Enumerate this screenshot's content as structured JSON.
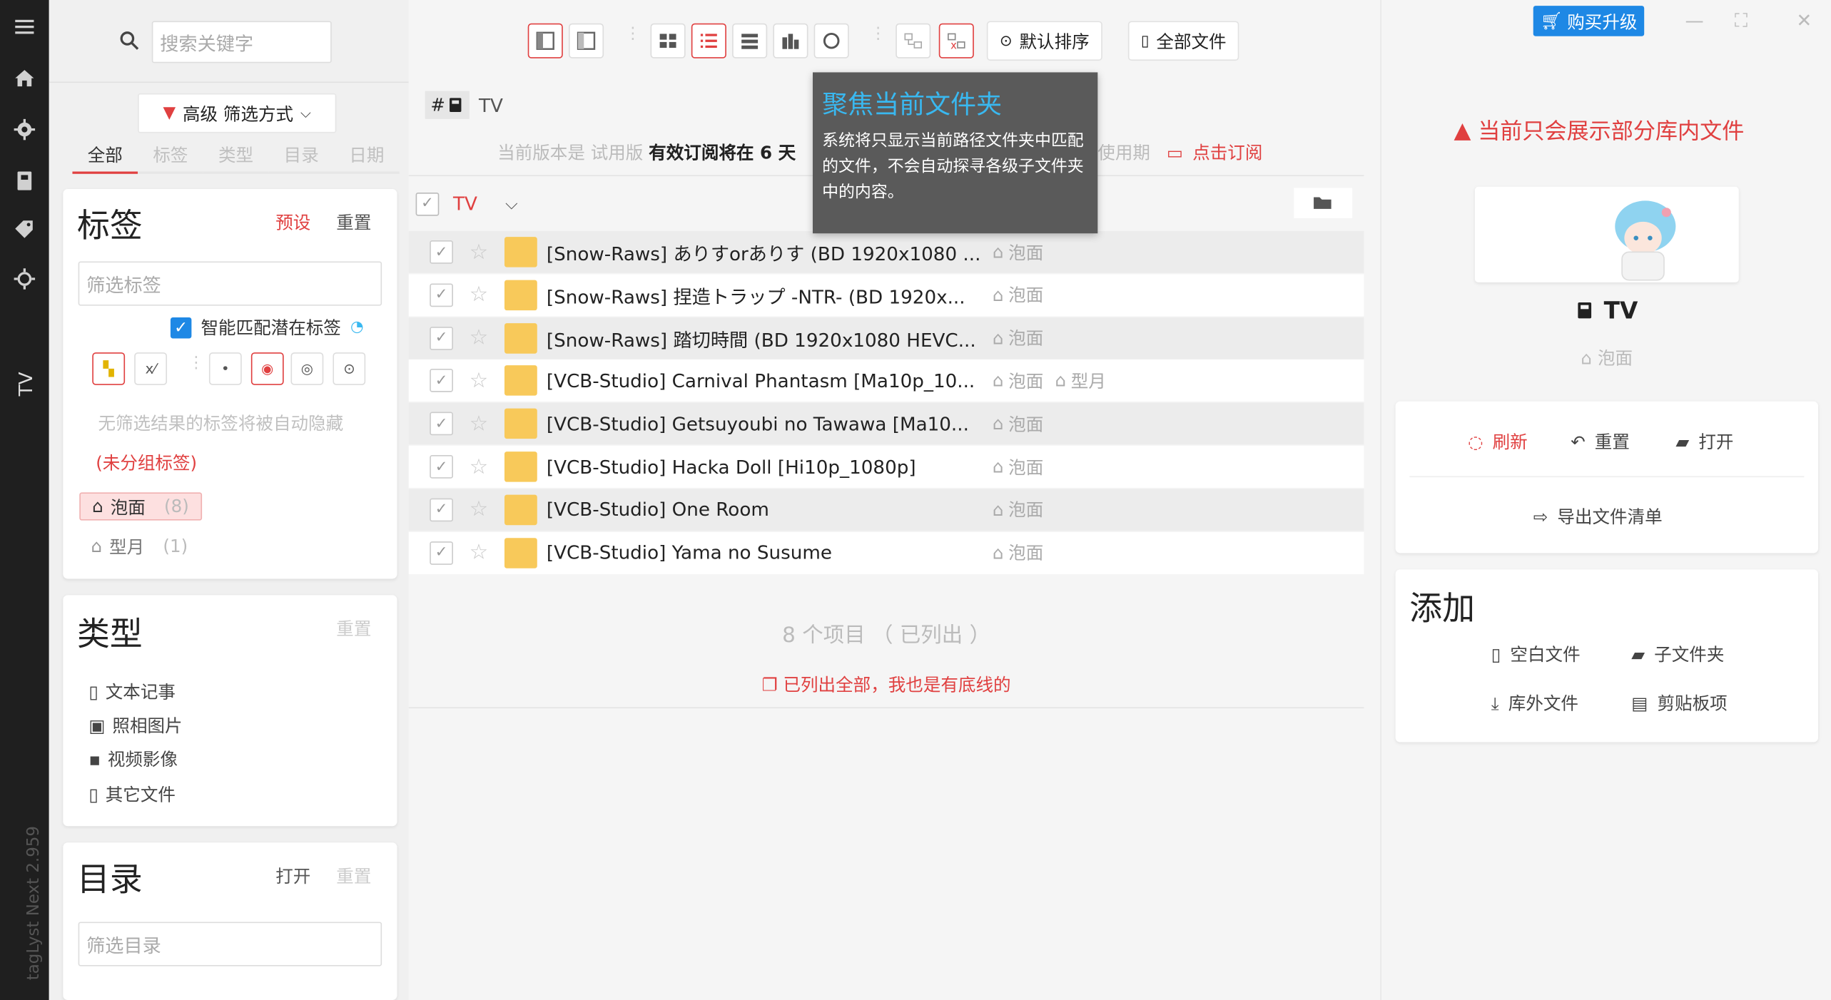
{
  "app": {
    "version_label": "tagLyst Next 2.959",
    "rail_folder": "TV"
  },
  "filter_panel": {
    "search_placeholder": "搜索关键字",
    "advanced_filter_label": "高级 筛选方式",
    "tabs": [
      {
        "label": "全部",
        "active": true
      },
      {
        "label": "标签",
        "active": false
      },
      {
        "label": "类型",
        "active": false
      },
      {
        "label": "目录",
        "active": false
      },
      {
        "label": "日期",
        "active": false
      }
    ],
    "tag_card": {
      "title": "标签",
      "preset": "预设",
      "reset": "重置",
      "filter_placeholder": "筛选标签",
      "smart_match": "智能匹配潜在标签",
      "hint": "无筛选结果的标签将被自动隐藏",
      "ungrouped": "(未分组标签)",
      "tags": [
        {
          "name": "泡面",
          "count": "(8)",
          "selected": true
        },
        {
          "name": "型月",
          "count": "(1)",
          "selected": false
        }
      ]
    },
    "type_card": {
      "title": "类型",
      "reset": "重置",
      "types": [
        {
          "label": "文本记事",
          "icon": "document-icon"
        },
        {
          "label": "照相图片",
          "icon": "image-icon"
        },
        {
          "label": "视频影像",
          "icon": "video-icon"
        },
        {
          "label": "其它文件",
          "icon": "file-icon"
        }
      ]
    },
    "dir_card": {
      "title": "目录",
      "open": "打开",
      "reset": "重置",
      "filter_placeholder": "筛选目录"
    }
  },
  "main": {
    "toolbar": {
      "sort_label": "默认排序",
      "scope_label": "全部文件"
    },
    "breadcrumb": {
      "hash": "#",
      "folder": "TV"
    },
    "trial": {
      "prefix": "当前版本是 试用版",
      "bold": "有效订阅将在 6 天",
      "suffix": "使用期",
      "subscribe": "点击订阅"
    },
    "list_header": {
      "folder": "TV"
    },
    "rows": [
      {
        "name": "[Snow-Raws] ありすorありす (BD 1920x1080 ...",
        "tags": [
          "泡面"
        ]
      },
      {
        "name": "[Snow-Raws] 捏造トラップ -NTR- (BD 1920x...",
        "tags": [
          "泡面"
        ]
      },
      {
        "name": "[Snow-Raws] 踏切時間 (BD 1920x1080 HEVC...",
        "tags": [
          "泡面"
        ]
      },
      {
        "name": "[VCB-Studio] Carnival Phantasm [Ma10p_10...",
        "tags": [
          "泡面",
          "型月"
        ]
      },
      {
        "name": "[VCB-Studio] Getsuyoubi no Tawawa [Ma10...",
        "tags": [
          "泡面"
        ]
      },
      {
        "name": "[VCB-Studio] Hacka Doll [Hi10p_1080p]",
        "tags": [
          "泡面"
        ]
      },
      {
        "name": "[VCB-Studio] One Room",
        "tags": [
          "泡面"
        ]
      },
      {
        "name": "[VCB-Studio] Yama no Susume",
        "tags": [
          "泡面"
        ]
      }
    ],
    "count_text": "8 个项目 （ 已列出 ）",
    "listed_all": "已列出全部，我也是有底线的",
    "tooltip": {
      "title": "聚焦当前文件夹",
      "body": "系统将只显示当前路径文件夹中匹配的文件，不会自动探寻各级子文件夹中的内容。"
    }
  },
  "right_panel": {
    "buy_label": "购买升级",
    "warning": "当前只会展示部分库内文件",
    "title": "TV",
    "tag": "泡面",
    "actions": {
      "refresh": "刷新",
      "reset": "重置",
      "open": "打开",
      "export": "导出文件清单"
    },
    "add_card": {
      "title": "添加",
      "blank_file": "空白文件",
      "subfolder": "子文件夹",
      "external_file": "库外文件",
      "clipboard": "剪贴板项"
    }
  },
  "colors": {
    "accent_red": "#e04040",
    "accent_blue": "#1e88e5",
    "folder_yellow": "#f8c95a",
    "tooltip_title": "#39b8f0"
  }
}
